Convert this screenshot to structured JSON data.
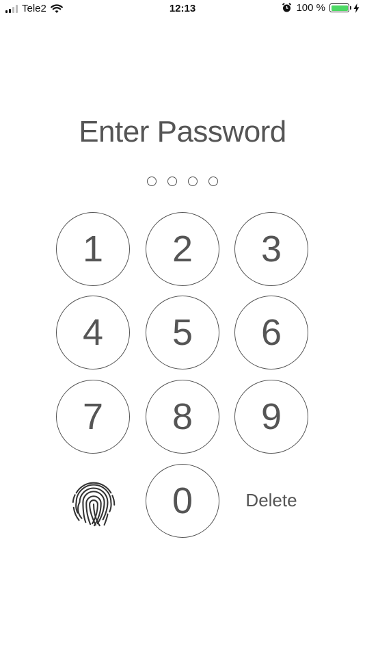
{
  "status_bar": {
    "carrier": "Tele2",
    "time": "12:13",
    "battery_percent_text": "100 %",
    "battery_level": 1.0,
    "icons": [
      "signal-icon",
      "wifi-icon",
      "alarm-icon",
      "battery-icon",
      "charging-icon"
    ]
  },
  "lock": {
    "title": "Enter Password",
    "entered_digits": 0,
    "passcode_length": 4
  },
  "keypad": {
    "keys": [
      "1",
      "2",
      "3",
      "4",
      "5",
      "6",
      "7",
      "8",
      "9",
      "0"
    ],
    "delete_label": "Delete",
    "biometric_icon": "fingerprint-icon"
  },
  "colors": {
    "ink": "#555555",
    "battery_green": "#4cd964"
  }
}
